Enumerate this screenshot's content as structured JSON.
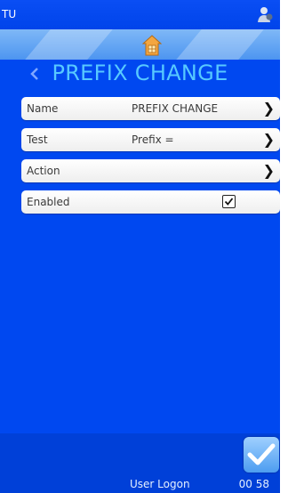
{
  "status_bar": {
    "title": "TU",
    "user_icon": "user-icon"
  },
  "home": {
    "icon": "home-icon"
  },
  "header": {
    "back_icon": "chevron-left-icon",
    "title": "PREFIX CHANGE"
  },
  "rows": [
    {
      "label": "Name",
      "value": "PREFIX CHANGE",
      "icon": "chevron-right-icon"
    },
    {
      "label": "Test",
      "value": "Prefix =",
      "icon": "chevron-right-icon"
    },
    {
      "label": "Action",
      "value": "",
      "icon": "chevron-right-icon"
    },
    {
      "label": "Enabled",
      "checked": true
    }
  ],
  "confirm": {
    "icon": "checkmark-icon"
  },
  "footer": {
    "user_logon": "User Logon",
    "time": "00 58"
  },
  "colors": {
    "background": "#0048f0",
    "title": "#57c9ff",
    "band": "#6aaaf5"
  }
}
